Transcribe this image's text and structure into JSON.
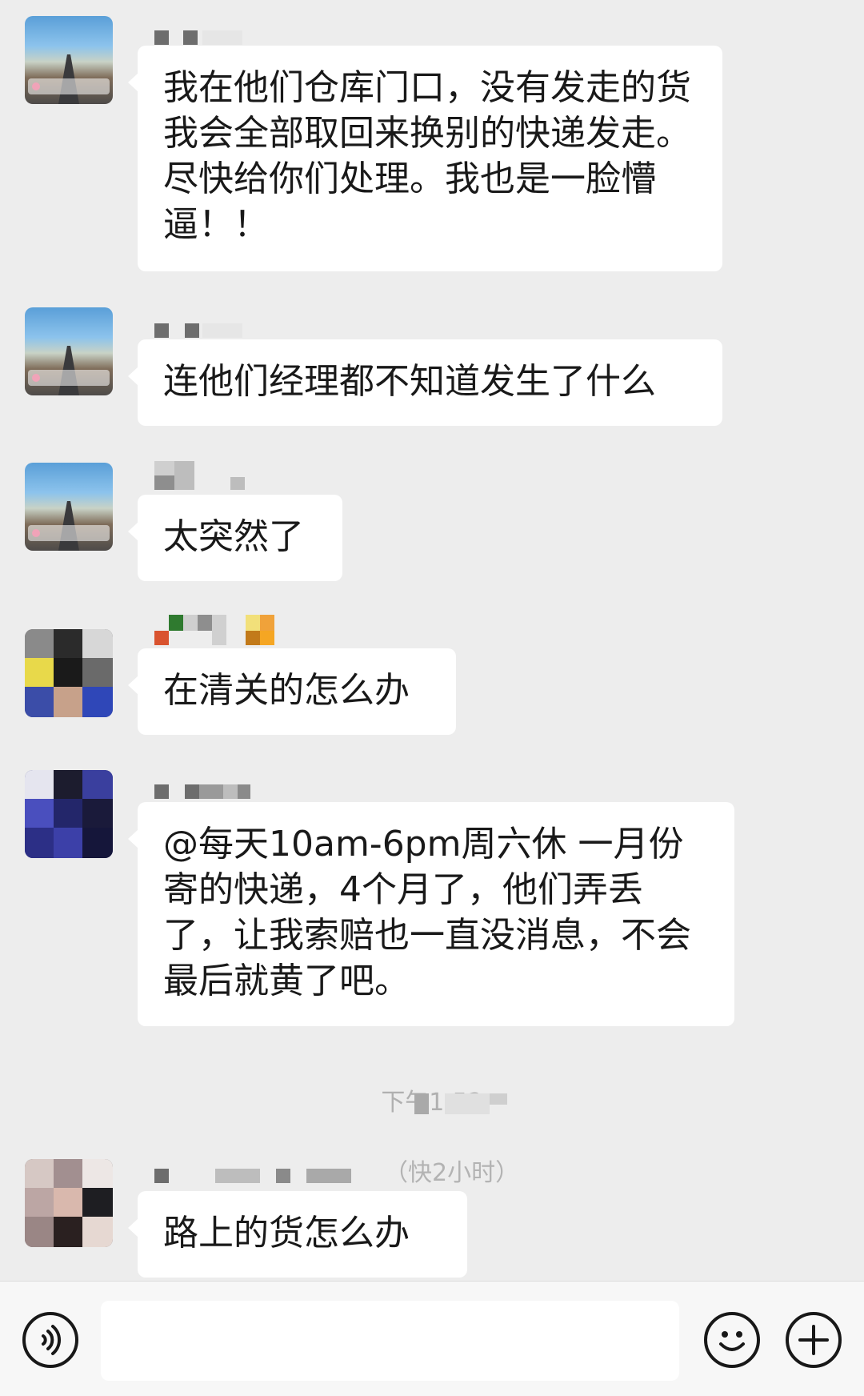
{
  "colors": {
    "background": "#ededed",
    "bubble": "#ffffff",
    "text": "#191919",
    "timestamp": "#b0b0b0",
    "input_bar": "#f7f7f7"
  },
  "messages": [
    {
      "sender_name": "",
      "avatar": "scenic-road-avatar",
      "text": "我在他们仓库门口，没有发走的货我会全部取回来换别的快递发走。尽快给你们处理。我也是一脸懵逼！！"
    },
    {
      "sender_name": "",
      "avatar": "scenic-road-avatar",
      "text": "连他们经理都不知道发生了什么"
    },
    {
      "sender_name": "",
      "avatar": "scenic-road-avatar",
      "text": "太突然了"
    },
    {
      "sender_name": "",
      "avatar": "camera-photo-avatar",
      "text": "在清关的怎么办"
    },
    {
      "sender_name": "",
      "avatar": "blue-pixel-avatar",
      "text": "@每天10am-6pm周六休 一月份寄的快递，4个月了，他们弄丢了，让我索赔也一直没消息，不会最后就黄了吧。"
    },
    {
      "sender_name": "（快2小时）",
      "avatar": "sunglasses-avatar",
      "text": "路上的货怎么办"
    }
  ],
  "timestamp": "下午1:52",
  "input_bar": {
    "placeholder": "",
    "voice_icon": "voice-icon",
    "emoji_icon": "emoji-icon",
    "plus_icon": "plus-icon"
  }
}
